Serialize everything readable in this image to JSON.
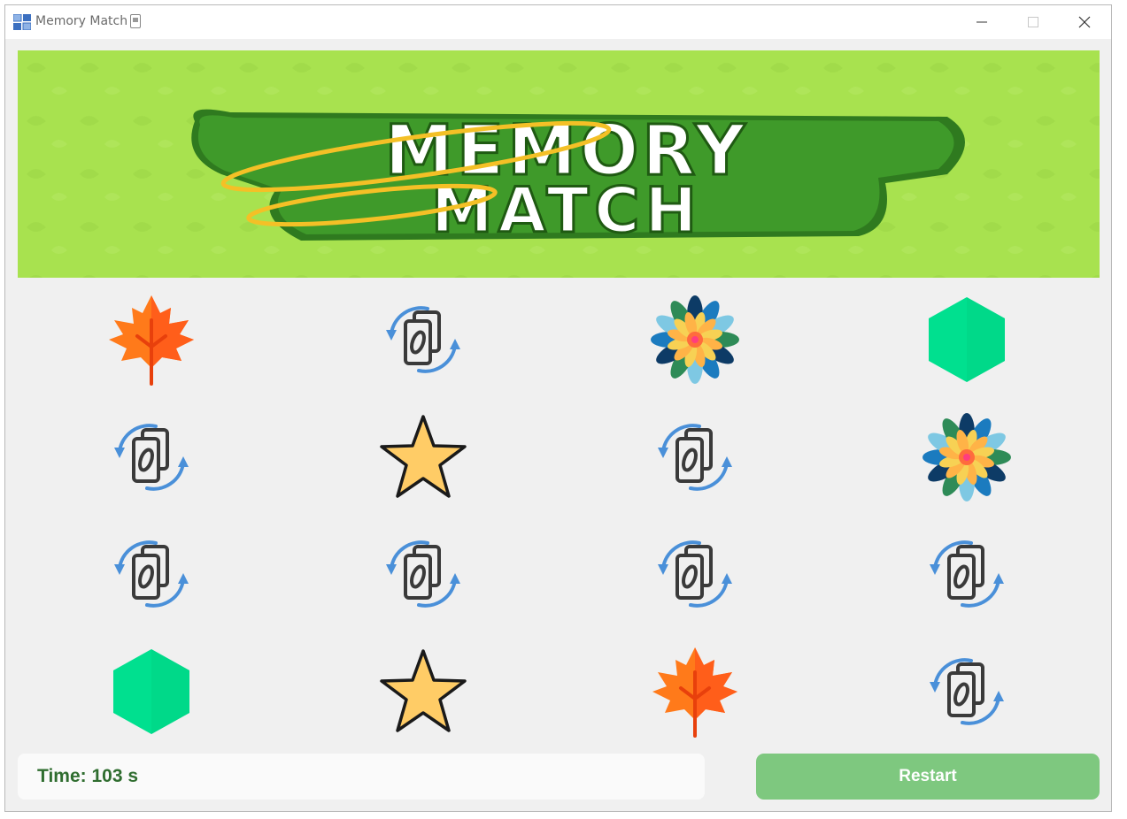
{
  "window": {
    "title": "Memory Match",
    "controls": [
      "minimize-icon",
      "maximize-icon",
      "close-icon"
    ]
  },
  "banner": {
    "line1": "MEMORY",
    "line2": "MATCH",
    "bg_color": "#a8e24f",
    "outline_color": "#2f7a1f"
  },
  "cards": [
    [
      "maple-leaf",
      "card-back",
      "flower",
      "hexagon"
    ],
    [
      "card-back",
      "star",
      "card-back",
      "flower"
    ],
    [
      "card-back",
      "card-back",
      "card-back",
      "card-back"
    ],
    [
      "hexagon",
      "star",
      "maple-leaf",
      "card-back"
    ]
  ],
  "status": {
    "time_label": "Time: 103 s"
  },
  "controls": {
    "restart_label": "Restart"
  },
  "colors": {
    "accent": "#7ec87f",
    "time_text": "#2f6d2f",
    "hexagon": "#00e08f",
    "star": "#ffcc66",
    "leaf": "#ff7a1a",
    "card_back_arrows": "#4a90d9"
  }
}
